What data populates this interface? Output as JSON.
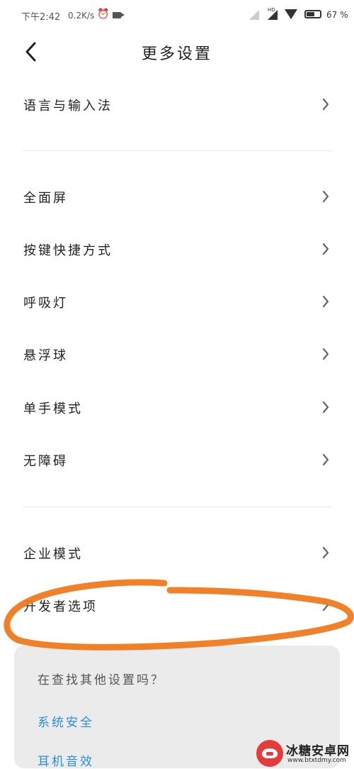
{
  "status_bar": {
    "time": "下午2:42",
    "net_speed": "0.2K/s",
    "alarm_icon": "alarm-clock-icon",
    "video_icon": "video-camera-icon",
    "hd_label": "HD",
    "battery_percent": 67,
    "battery_text": "67 %"
  },
  "header": {
    "title": "更多设置",
    "back_icon": "chevron-left-icon"
  },
  "settings": {
    "group1": [
      {
        "label": "语言与输入法"
      }
    ],
    "group2": [
      {
        "label": "全面屏"
      },
      {
        "label": "按键快捷方式"
      },
      {
        "label": "呼吸灯"
      },
      {
        "label": "悬浮球"
      },
      {
        "label": "单手模式"
      },
      {
        "label": "无障碍"
      }
    ],
    "group3": [
      {
        "label": "企业模式"
      },
      {
        "label": "开发者选项"
      }
    ]
  },
  "suggestion_card": {
    "title": "在查找其他设置吗？",
    "links": [
      "系统安全",
      "耳机音效"
    ]
  },
  "colors": {
    "link": "#2b8fd6",
    "annotation": "#f07a1e",
    "card_bg": "#ebebeb"
  },
  "watermark": {
    "name": "冰糖安卓网",
    "url": "www.btxtdmy.com"
  }
}
